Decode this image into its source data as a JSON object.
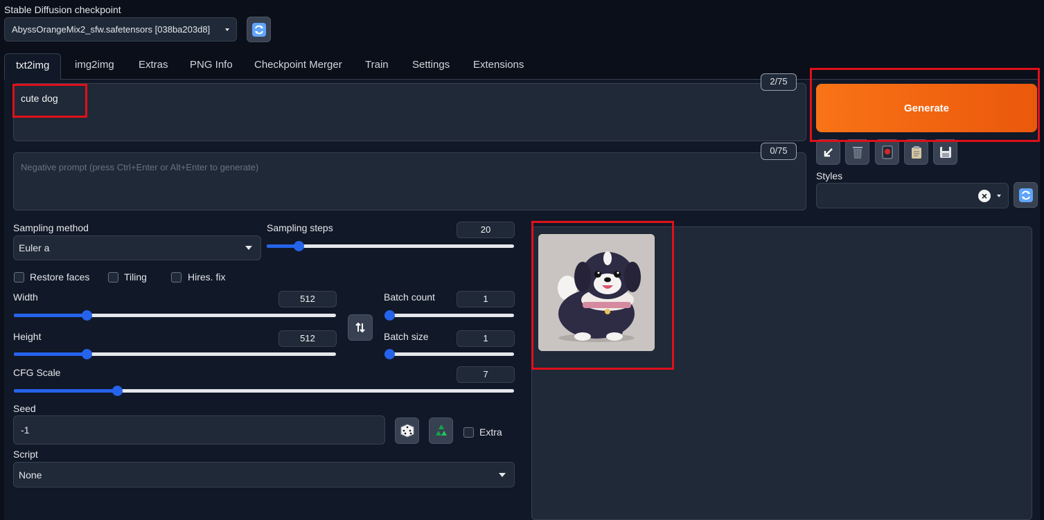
{
  "checkpoint": {
    "label": "Stable Diffusion checkpoint",
    "value": "AbyssOrangeMix2_sfw.safetensors [038ba203d8]"
  },
  "tabs": [
    {
      "label": "txt2img"
    },
    {
      "label": "img2img"
    },
    {
      "label": "Extras"
    },
    {
      "label": "PNG Info"
    },
    {
      "label": "Checkpoint Merger"
    },
    {
      "label": "Train"
    },
    {
      "label": "Settings"
    },
    {
      "label": "Extensions"
    }
  ],
  "prompt": {
    "value": "cute dog",
    "token_count": "2/75"
  },
  "negative_prompt": {
    "placeholder": "Negative prompt (press Ctrl+Enter or Alt+Enter to generate)",
    "token_count": "0/75"
  },
  "generate": {
    "label": "Generate"
  },
  "styles": {
    "label": "Styles",
    "value": "",
    "clear": "×"
  },
  "sampling_method": {
    "label": "Sampling method",
    "value": "Euler a"
  },
  "sampling_steps": {
    "label": "Sampling steps",
    "value": "20",
    "min": 1,
    "max": 150,
    "level": 20
  },
  "checkboxes": {
    "restore_faces": "Restore faces",
    "tiling": "Tiling",
    "hires_fix": "Hires. fix"
  },
  "width": {
    "label": "Width",
    "value": "512",
    "min": 64,
    "max": 2048,
    "level": 512
  },
  "height": {
    "label": "Height",
    "value": "512",
    "min": 64,
    "max": 2048,
    "level": 512
  },
  "batch_count": {
    "label": "Batch count",
    "value": "1",
    "min": 1,
    "max": 100,
    "level": 1
  },
  "batch_size": {
    "label": "Batch size",
    "value": "1",
    "min": 1,
    "max": 8,
    "level": 1
  },
  "cfg_scale": {
    "label": "CFG Scale",
    "value": "7",
    "min": 1,
    "max": 30,
    "level": 7
  },
  "seed": {
    "label": "Seed",
    "value": "-1",
    "extra_label": "Extra"
  },
  "script": {
    "label": "Script",
    "value": "None"
  },
  "colors": {
    "accent": "#2563eb",
    "generate": "#f97316",
    "highlight": "#e0101a"
  }
}
